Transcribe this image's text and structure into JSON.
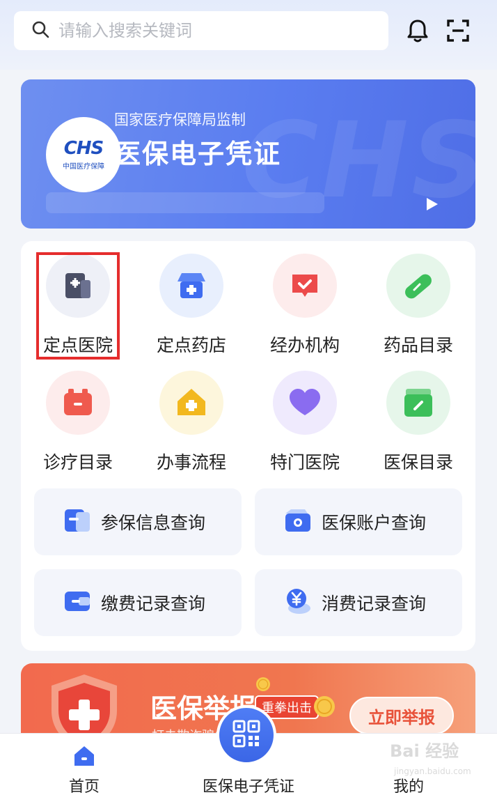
{
  "search": {
    "placeholder": "请输入搜索关键词"
  },
  "header_icons": [
    "bell-icon",
    "scan-icon"
  ],
  "banner": {
    "logo_text": "CHS",
    "logo_subtext": "中国医疗保障",
    "subtitle": "国家医疗保障局监制",
    "title": "医保电子凭证",
    "watermark": "CHS"
  },
  "grid": [
    {
      "label": "定点医院",
      "icon": "hospital-icon",
      "bg": "#eef0f7",
      "color": "#4a4f66"
    },
    {
      "label": "定点药店",
      "icon": "pharmacy-icon",
      "bg": "#e8effd",
      "color": "#3f6cf0"
    },
    {
      "label": "经办机构",
      "icon": "agency-icon",
      "bg": "#fdecec",
      "color": "#ec4a4a"
    },
    {
      "label": "药品目录",
      "icon": "pill-icon",
      "bg": "#e6f6ea",
      "color": "#3cbf5a"
    },
    {
      "label": "诊疗目录",
      "icon": "treatment-icon",
      "bg": "#fdecec",
      "color": "#ef5a4e"
    },
    {
      "label": "办事流程",
      "icon": "process-icon",
      "bg": "#fdf6dc",
      "color": "#f2b81f"
    },
    {
      "label": "特门医院",
      "icon": "heart-icon",
      "bg": "#efeafd",
      "color": "#8a6cf0"
    },
    {
      "label": "医保目录",
      "icon": "catalog-icon",
      "bg": "#e6f6ea",
      "color": "#3cbf5a"
    }
  ],
  "queries": [
    {
      "label": "参保信息查询",
      "icon": "insurance-info-icon"
    },
    {
      "label": "医保账户查询",
      "icon": "account-icon"
    },
    {
      "label": "缴费记录查询",
      "icon": "wallet-icon"
    },
    {
      "label": "消费记录查询",
      "icon": "yuan-icon"
    }
  ],
  "report": {
    "title": "医保举报",
    "badge": "重拳出击",
    "subtitle": "打击欺诈骗保",
    "button": "立即举报"
  },
  "tabbar": {
    "home": "首页",
    "voucher": "医保电子凭证",
    "mine": "我的"
  },
  "watermark": {
    "text": "Bai 经验",
    "sub": "jingyan.baidu.com"
  },
  "colors": {
    "accent": "#3f6cf0",
    "highlight_border": "#e52d2d",
    "report_bg": "#f26a4e"
  }
}
